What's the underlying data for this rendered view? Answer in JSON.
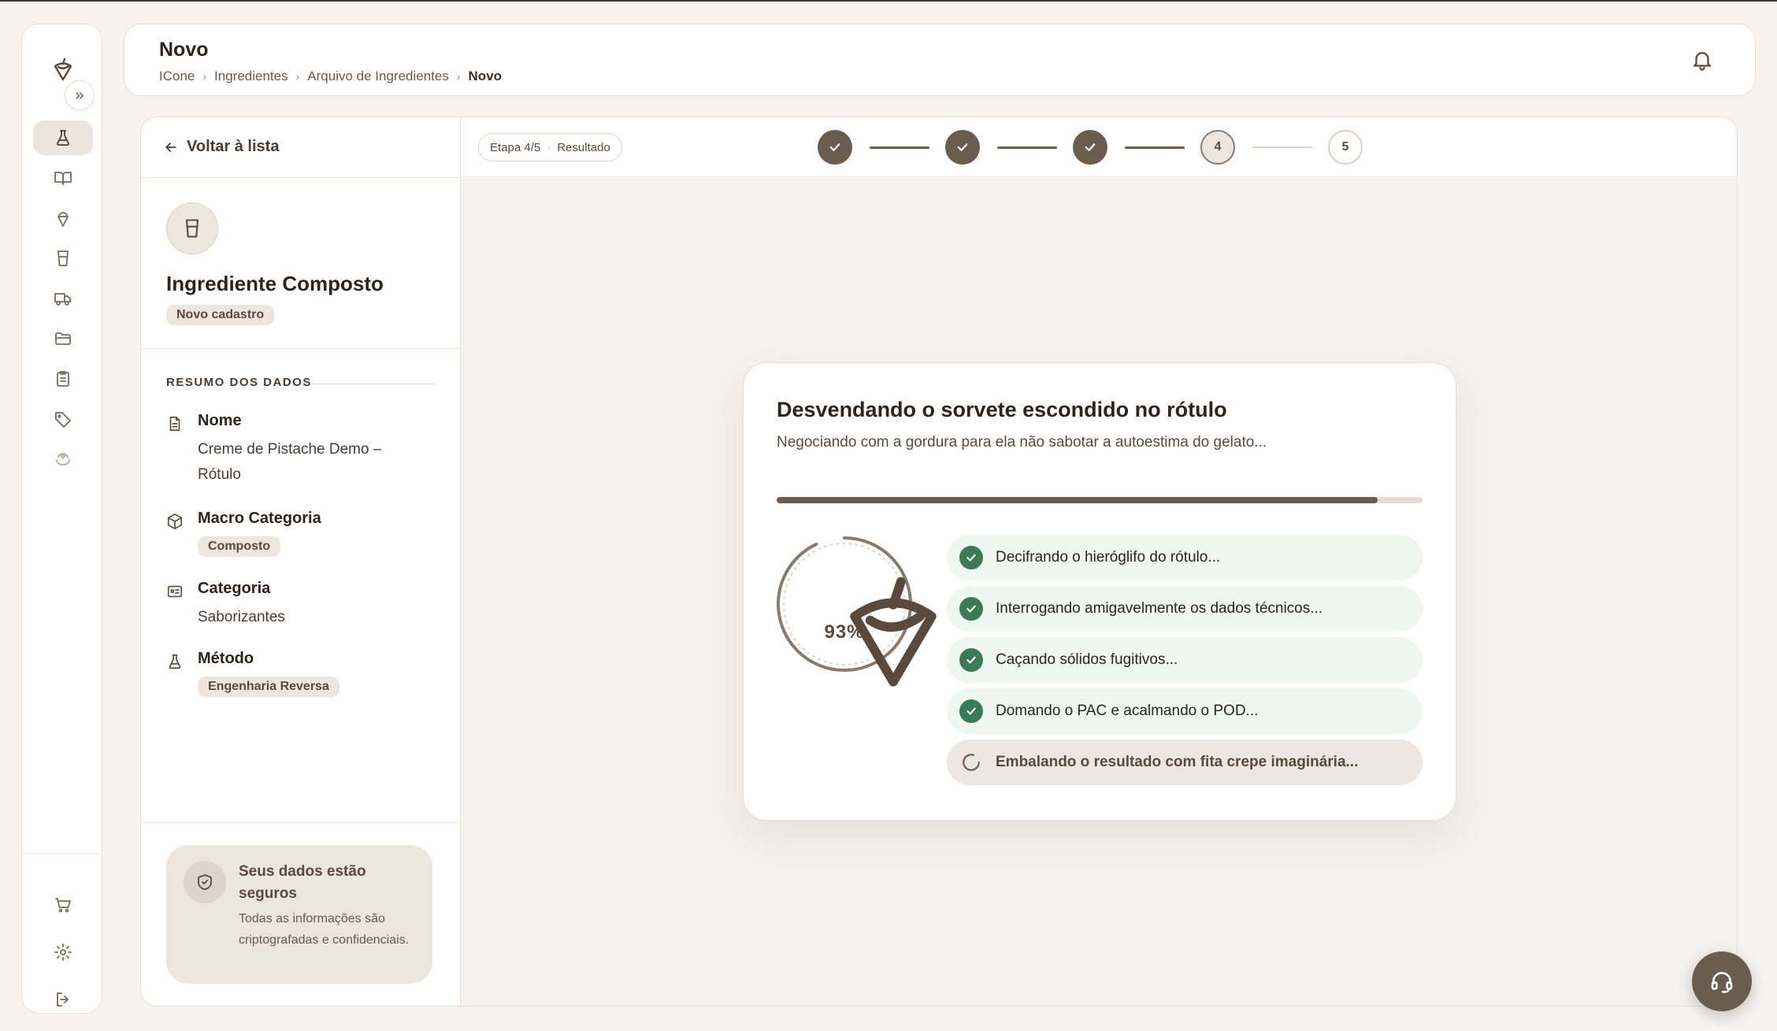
{
  "header": {
    "title": "Novo",
    "breadcrumb": [
      "ICone",
      "Ingredientes",
      "Arquivo de Ingredientes",
      "Novo"
    ]
  },
  "rail": {
    "expand_label": "»",
    "items": [
      "flask-icon",
      "book-icon",
      "ice-cream-icon",
      "cup-icon",
      "truck-icon",
      "folder-icon",
      "clipboard-icon",
      "tag-icon",
      "sparkle-icon"
    ],
    "bottom_items": [
      "cart-icon",
      "gear-icon",
      "logout-icon"
    ]
  },
  "side": {
    "back_label": "Voltar à lista",
    "ingredient_title": "Ingrediente Composto",
    "ingredient_badge": "Novo cadastro",
    "summary_label": "RESUMO DOS DADOS",
    "fields": {
      "nome": {
        "label": "Nome",
        "value": "Creme de Pistache Demo – Rótulo"
      },
      "macro": {
        "label": "Macro Categoria",
        "value": "Composto"
      },
      "categoria": {
        "label": "Categoria",
        "value": "Saborizantes"
      },
      "metodo": {
        "label": "Método",
        "value": "Engenharia Reversa"
      }
    },
    "safe": {
      "title": "Seus dados estão seguros",
      "text": "Todas as informações são criptografadas e confidenciais."
    }
  },
  "stepper": {
    "pill_step": "Etapa 4/5",
    "pill_name": "Resultado",
    "current_label": "4",
    "last_label": "5",
    "current": 4,
    "total": 5
  },
  "loading": {
    "title": "Desvendando o sorvete escondido no rótulo",
    "subtitle": "Negociando com a gordura para ela não sabotar a autoestima do gelato...",
    "percent": 93,
    "percent_label": "93%",
    "tasks": [
      {
        "text": "Decifrando o hieróglifo do rótulo...",
        "status": "done"
      },
      {
        "text": "Interrogando amigavelmente os dados técnicos...",
        "status": "done"
      },
      {
        "text": "Caçando sólidos fugitivos...",
        "status": "done"
      },
      {
        "text": "Domando o PAC e acalmando o POD...",
        "status": "done"
      },
      {
        "text": "Embalando o resultado com fita crepe imaginária...",
        "status": "pending"
      }
    ]
  },
  "colors": {
    "accent": "#6b5c50",
    "success": "#3b7a57",
    "background": "#f6f4f0"
  }
}
